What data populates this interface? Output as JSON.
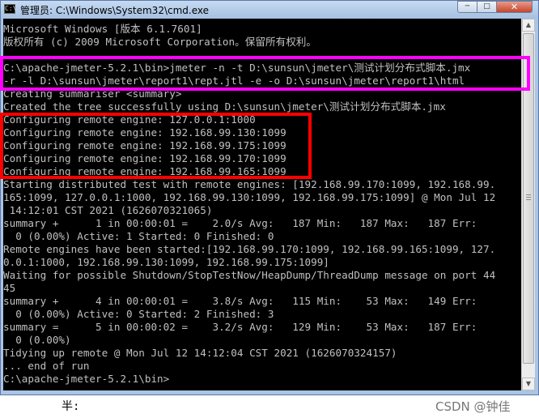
{
  "window": {
    "title": "管理员: C:\\Windows\\System32\\cmd.exe",
    "app_icon": "C:\\",
    "buttons": {
      "minimize": "─",
      "maximize": "□",
      "close": "✕"
    }
  },
  "console_lines": [
    "Microsoft Windows [版本 6.1.7601]",
    "版权所有 (c) 2009 Microsoft Corporation。保留所有权利。",
    "",
    "C:\\apache-jmeter-5.2.1\\bin>jmeter -n -t D:\\sunsun\\jmeter\\测试计划分布式脚本.jmx",
    "-r -l D:\\sunsun\\jmeter\\report1\\rept.jtl -e -o D:\\sunsun\\jmeter\\report1\\html",
    "Creating summariser <summary>",
    "Created the tree successfully using D:\\sunsun\\jmeter\\测试计划分布式脚本.jmx",
    "Configuring remote engine: 127.0.0.1:1000",
    "Configuring remote engine: 192.168.99.130:1099",
    "Configuring remote engine: 192.168.99.175:1099",
    "Configuring remote engine: 192.168.99.170:1099",
    "Configuring remote engine: 192.168.99.165:1099",
    "Starting distributed test with remote engines: [192.168.99.170:1099, 192.168.99.",
    "165:1099, 127.0.0.1:1000, 192.168.99.130:1099, 192.168.99.175:1099] @ Mon Jul 12",
    " 14:12:01 CST 2021 (1626070321065)",
    "summary +      1 in 00:00:01 =    2.0/s Avg:   187 Min:   187 Max:   187 Err:",
    "  0 (0.00%) Active: 1 Started: 0 Finished: 0",
    "Remote engines have been started:[192.168.99.170:1099, 192.168.99.165:1099, 127.",
    "0.0.1:1000, 192.168.99.130:1099, 192.168.99.175:1099]",
    "Waiting for possible Shutdown/StopTestNow/HeapDump/ThreadDump message on port 44",
    "45",
    "summary +      4 in 00:00:01 =    3.8/s Avg:   115 Min:    53 Max:   149 Err:",
    "  0 (0.00%) Active: 0 Started: 2 Finished: 3",
    "summary =      5 in 00:00:02 =    3.2/s Avg:   129 Min:    53 Max:   187 Err:",
    "  0 (0.00%)",
    "Tidying up remote @ Mon Jul 12 14:12:04 CST 2021 (1626070324157)",
    "... end of run",
    "C:\\apache-jmeter-5.2.1\\bin>"
  ],
  "below_window": {
    "left_text": "半:",
    "watermark": "CSDN @钟佳"
  },
  "colors": {
    "console_bg": "#000000",
    "console_text": "#c0c0c0",
    "highlight_magenta": "#ff00ff",
    "highlight_red": "#ff0000"
  }
}
